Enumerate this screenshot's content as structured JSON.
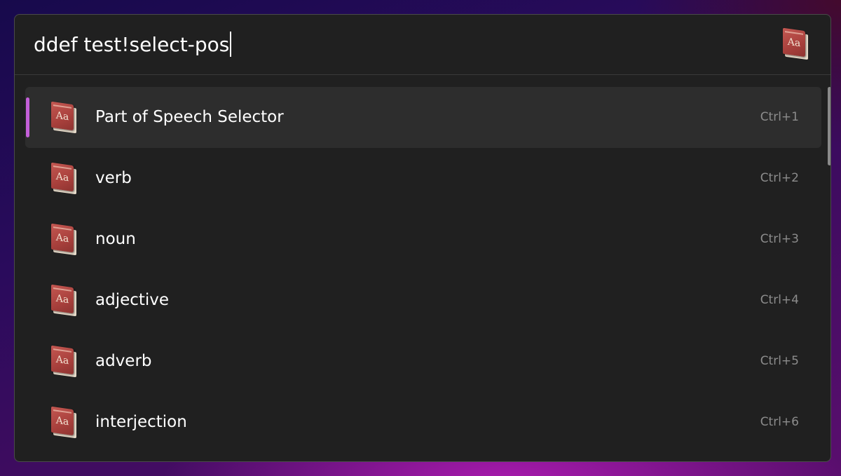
{
  "search": {
    "query": "ddef test!select-pos",
    "plugin_icon": "dictionary-book-icon"
  },
  "results": [
    {
      "title": "Part of Speech Selector",
      "shortcut": "Ctrl+1",
      "icon": "dictionary-book-icon",
      "icon_text": "Aa",
      "selected": true
    },
    {
      "title": "verb",
      "shortcut": "Ctrl+2",
      "icon": "dictionary-book-icon",
      "icon_text": "Aa",
      "selected": false
    },
    {
      "title": "noun",
      "shortcut": "Ctrl+3",
      "icon": "dictionary-book-icon",
      "icon_text": "Aa",
      "selected": false
    },
    {
      "title": "adjective",
      "shortcut": "Ctrl+4",
      "icon": "dictionary-book-icon",
      "icon_text": "Aa",
      "selected": false
    },
    {
      "title": "adverb",
      "shortcut": "Ctrl+5",
      "icon": "dictionary-book-icon",
      "icon_text": "Aa",
      "selected": false
    },
    {
      "title": "interjection",
      "shortcut": "Ctrl+6",
      "icon": "dictionary-book-icon",
      "icon_text": "Aa",
      "selected": false
    }
  ],
  "colors": {
    "accent": "#c35fd8",
    "panel": "#202020",
    "selected_row": "#2d2d2d",
    "shortcut_text": "#8c8c8c"
  }
}
